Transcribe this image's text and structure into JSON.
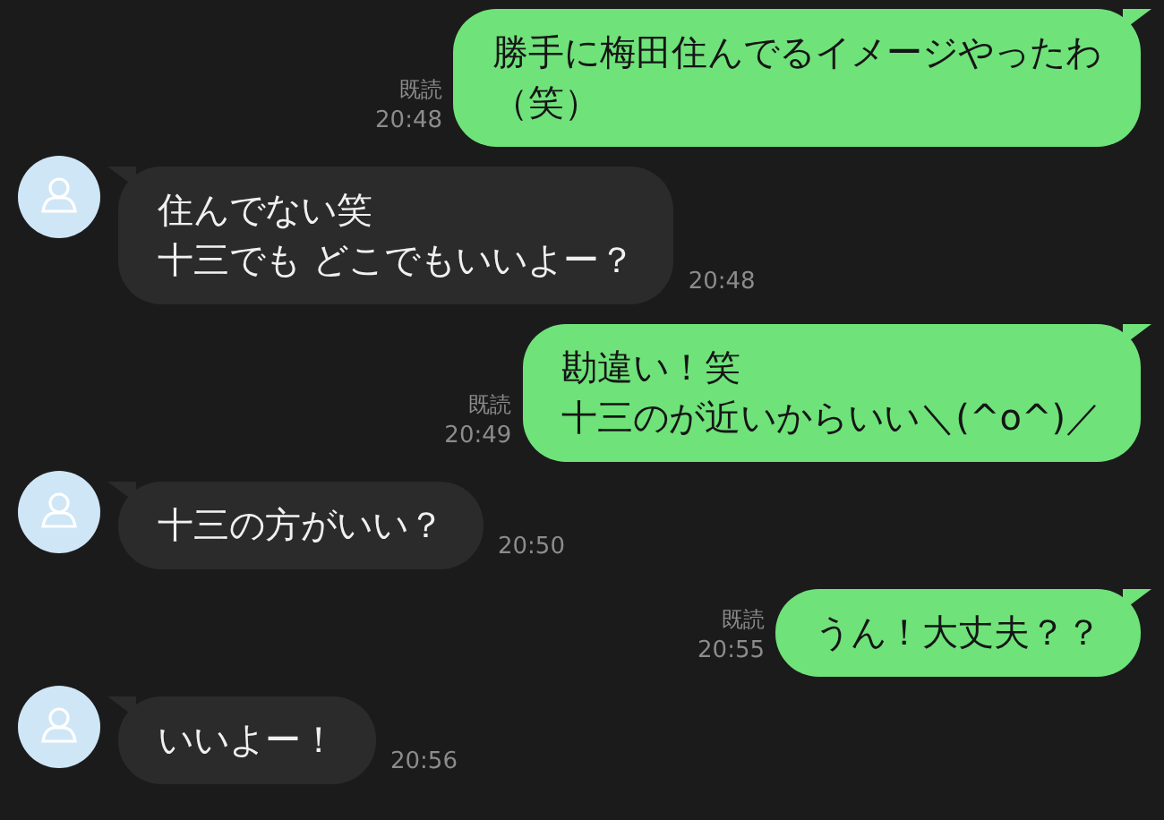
{
  "messages": [
    {
      "kind": "sent",
      "lines": [
        "勝手に梅田住んでるイメージやったわ",
        "（笑）"
      ],
      "read": "既読",
      "time": "20:48"
    },
    {
      "kind": "received",
      "lines": [
        "住んでない笑",
        "十三でも どこでもいいよー？"
      ],
      "time": "20:48"
    },
    {
      "kind": "sent",
      "lines": [
        "勘違い！笑",
        "十三のが近いからいい＼(^o^)／"
      ],
      "read": "既読",
      "time": "20:49"
    },
    {
      "kind": "received",
      "lines": [
        "十三の方がいい？"
      ],
      "time": "20:50"
    },
    {
      "kind": "sent",
      "lines": [
        "うん！大丈夫？？"
      ],
      "read": "既読",
      "time": "20:55"
    },
    {
      "kind": "received",
      "lines": [
        "いいよー！"
      ],
      "time": "20:56"
    }
  ]
}
